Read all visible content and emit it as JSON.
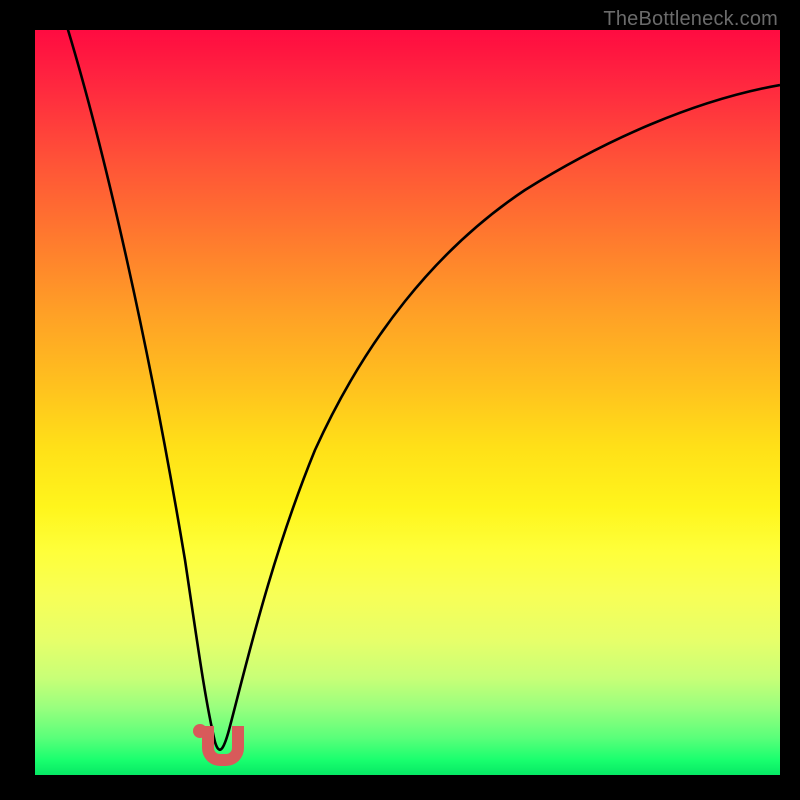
{
  "watermark": "TheBottleneck.com",
  "colors": {
    "frame": "#000000",
    "curve": "#000000",
    "marker": "#d85a5a",
    "gradient_top": "#ff0b41",
    "gradient_mid": "#ffe018",
    "gradient_bottom": "#06e864"
  },
  "chart_data": {
    "type": "line",
    "title": "",
    "xlabel": "",
    "ylabel": "",
    "xlim": [
      0,
      100
    ],
    "ylim": [
      0,
      100
    ],
    "grid": false,
    "legend": false,
    "annotations": [
      "TheBottleneck.com"
    ],
    "series": [
      {
        "name": "bottleneck-curve",
        "x": [
          0,
          5,
          10,
          15,
          18,
          20,
          22,
          24,
          25,
          28,
          32,
          38,
          45,
          55,
          65,
          75,
          85,
          95,
          100
        ],
        "y": [
          100,
          84,
          65,
          42,
          24,
          10,
          2,
          0,
          2,
          14,
          30,
          45,
          56,
          66,
          73,
          77,
          80,
          82,
          82
        ]
      }
    ],
    "markers": [
      {
        "name": "dot",
        "x": 21.5,
        "y": 4
      },
      {
        "name": "u-shape",
        "x_range": [
          22.5,
          26.5
        ],
        "y_range": [
          0,
          5
        ]
      }
    ],
    "background_gradient": {
      "direction": "vertical",
      "meaning": "value-color scale",
      "stops": [
        {
          "pos": 0.0,
          "color": "#ff0b41"
        },
        {
          "pos": 0.5,
          "color": "#ffe018"
        },
        {
          "pos": 1.0,
          "color": "#06e864"
        }
      ]
    }
  }
}
